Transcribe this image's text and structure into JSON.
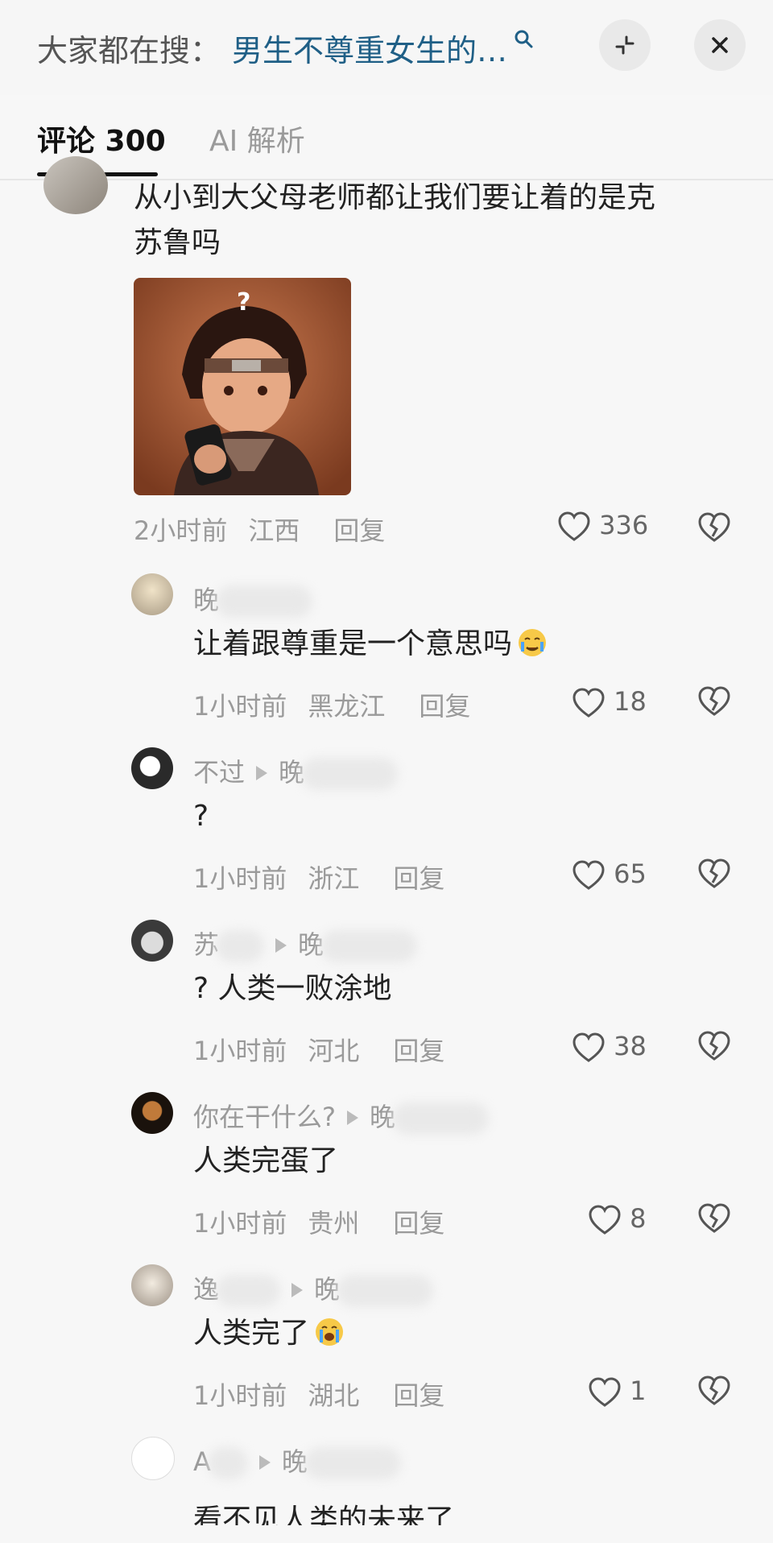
{
  "header": {
    "search_prefix": "大家都在搜：",
    "search_query": "男生不尊重女生的…"
  },
  "tabs": [
    {
      "label": "评论 300"
    },
    {
      "label": "AI 解析"
    }
  ],
  "comments": [
    {
      "text_line1": "从小到大父母老师都让我们要让着的是克",
      "text_line2": "苏鲁吗",
      "time": "2小时前",
      "location": "江西",
      "reply": "回复",
      "likes": "336"
    }
  ],
  "replies": [
    {
      "name": "晚",
      "text": "让着跟尊重是一个意思吗",
      "time": "1小时前",
      "location": "黑龙江",
      "reply": "回复",
      "likes": "18"
    },
    {
      "name": "不过",
      "reply_to": "晚",
      "text": "?",
      "time": "1小时前",
      "location": "浙江",
      "reply": "回复",
      "likes": "65"
    },
    {
      "name": "苏",
      "reply_to": "晚",
      "text": "? 人类一败涂地",
      "time": "1小时前",
      "location": "河北",
      "reply": "回复",
      "likes": "38"
    },
    {
      "name": "你在干什么?",
      "reply_to": "晚",
      "text": "人类完蛋了",
      "time": "1小时前",
      "location": "贵州",
      "reply": "回复",
      "likes": "8"
    },
    {
      "name": "逸",
      "reply_to": "晚",
      "text": "人类完了",
      "time": "1小时前",
      "location": "湖北",
      "reply": "回复",
      "likes": "1"
    },
    {
      "name": "A",
      "reply_to": "晚",
      "text": "看不见人类的未来了"
    }
  ],
  "colors": {
    "search_query": "#1f5f86",
    "muted_text": "#9a9a9a",
    "body_text": "#222222"
  }
}
